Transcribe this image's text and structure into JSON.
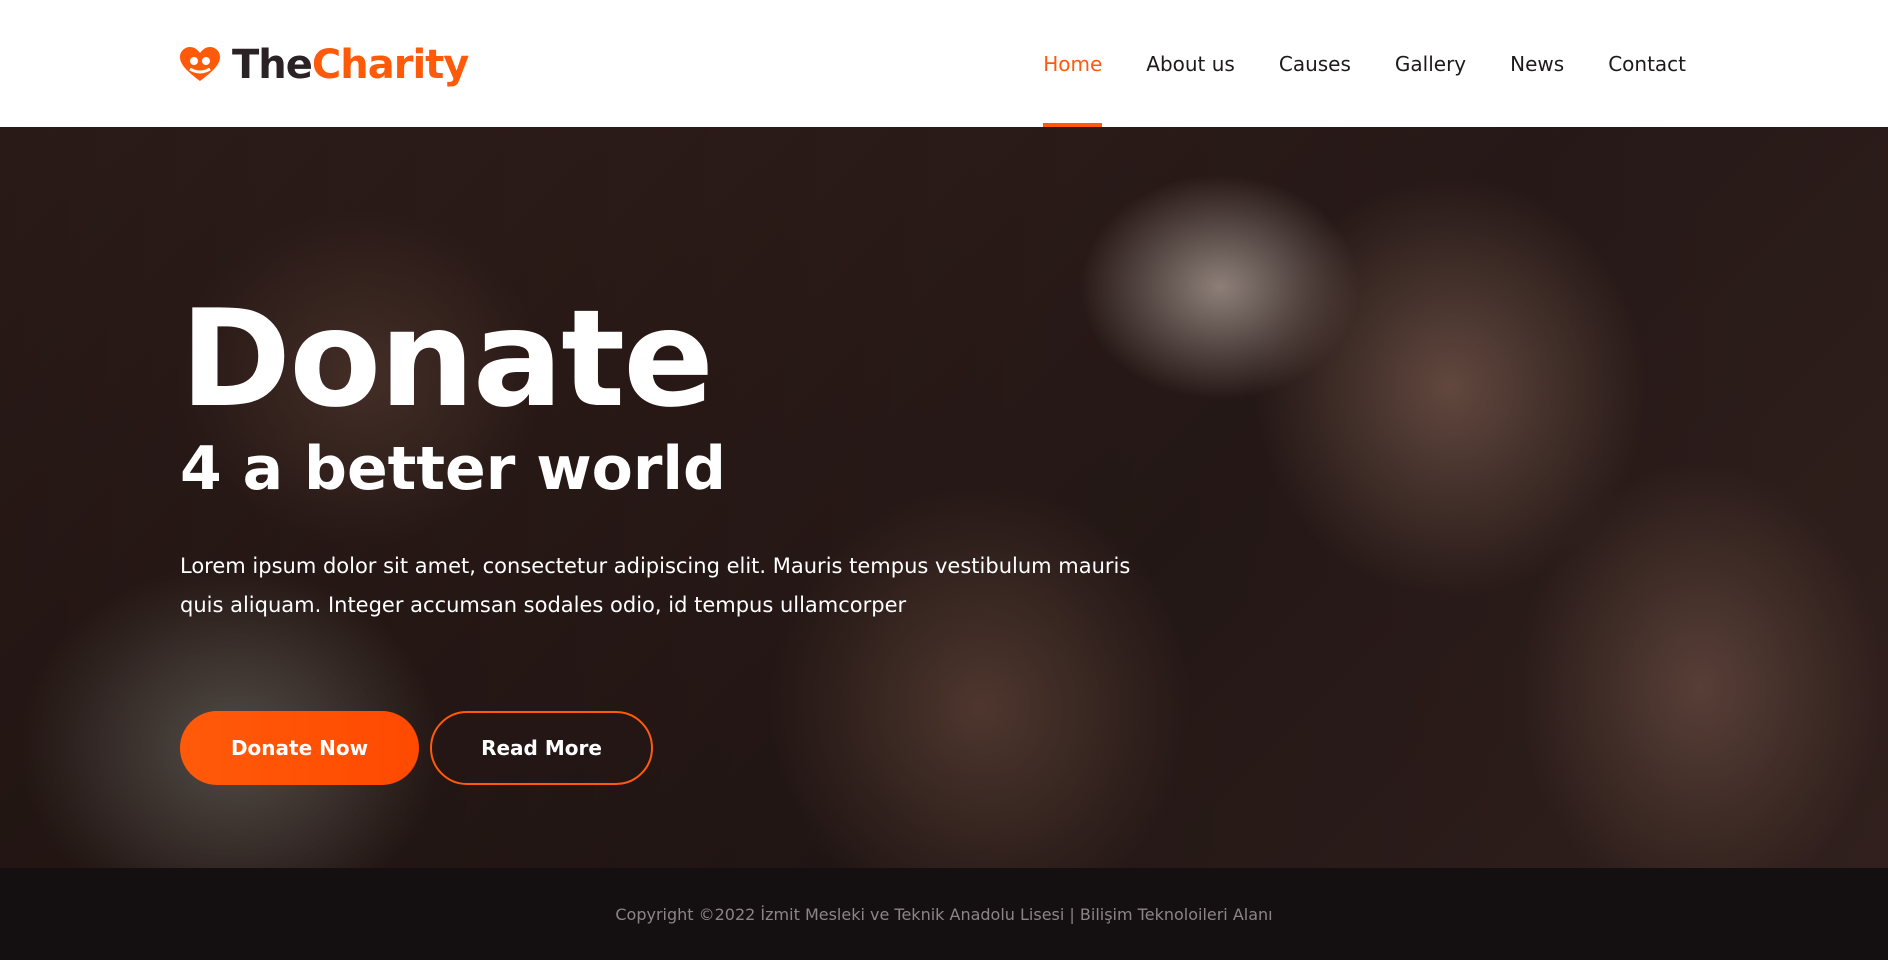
{
  "brand": {
    "name_part1": "The",
    "name_part2": "Charity",
    "icon": "heart-hands-icon",
    "accent_color": "#ff5a0a"
  },
  "nav": {
    "items": [
      {
        "label": "Home",
        "active": true
      },
      {
        "label": "About us",
        "active": false
      },
      {
        "label": "Causes",
        "active": false
      },
      {
        "label": "Gallery",
        "active": false
      },
      {
        "label": "News",
        "active": false
      },
      {
        "label": "Contact",
        "active": false
      }
    ]
  },
  "hero": {
    "title": "Donate",
    "subtitle": "4 a better world",
    "text": "Lorem ipsum dolor sit amet, consectetur adipiscing elit. Mauris tempus vestibulum mauris quis aliquam. Integer accumsan sodales odio, id tempus ullamcorper",
    "primary_button": "Donate Now",
    "secondary_button": "Read More"
  },
  "footer": {
    "copyright": "Copyright ©2022 İzmit Mesleki ve Teknik Anadolu Lisesi | Bilişim Teknoloileri Alanı"
  }
}
